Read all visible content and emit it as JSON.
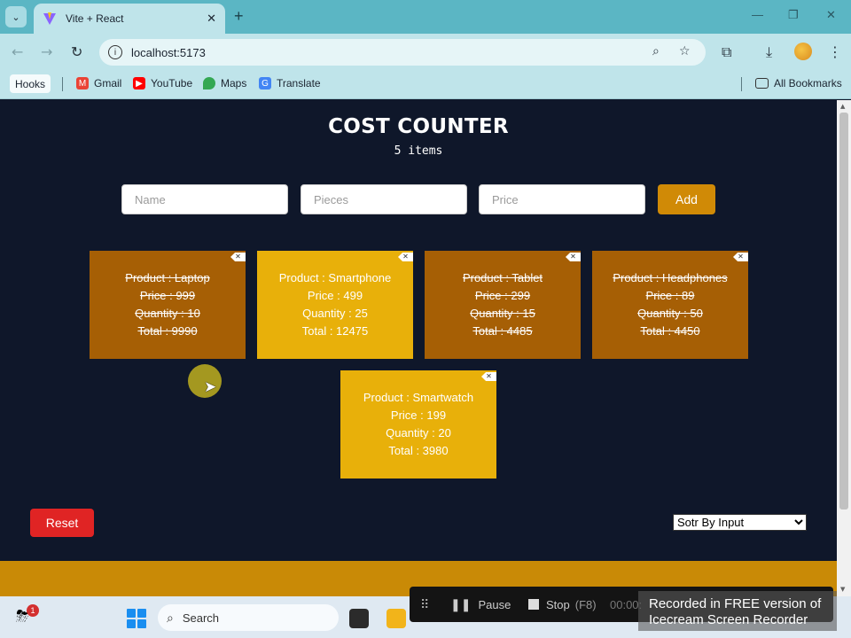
{
  "browser": {
    "tab_title": "Vite + React",
    "url": "localhost:5173",
    "window_controls": {
      "minimize": "—",
      "restore": "❐",
      "close": "✕"
    },
    "bookmarks": [
      {
        "label": "Hooks",
        "icon": "folder-chip"
      },
      {
        "label": "Gmail",
        "icon": "gmail-icon"
      },
      {
        "label": "YouTube",
        "icon": "youtube-icon"
      },
      {
        "label": "Maps",
        "icon": "maps-icon"
      },
      {
        "label": "Translate",
        "icon": "translate-icon"
      }
    ],
    "all_bookmarks_label": "All Bookmarks"
  },
  "app": {
    "title": "COST COUNTER",
    "count_label": "5 items",
    "form": {
      "name_placeholder": "Name",
      "pieces_placeholder": "Pieces",
      "price_placeholder": "Price",
      "add_label": "Add"
    },
    "items": [
      {
        "product": "Product : Laptop",
        "price": "Price : 999",
        "quantity": "Quantity : 10",
        "total": "Total : 9990",
        "status": "done",
        "color": "#a65f05"
      },
      {
        "product": "Product : Smartphone",
        "price": "Price : 499",
        "quantity": "Quantity : 25",
        "total": "Total : 12475",
        "status": "active",
        "color": "#e8b00a"
      },
      {
        "product": "Product : Tablet",
        "price": "Price : 299",
        "quantity": "Quantity : 15",
        "total": "Total : 4485",
        "status": "done",
        "color": "#a65f05"
      },
      {
        "product": "Product : Headphones",
        "price": "Price : 89",
        "quantity": "Quantity : 50",
        "total": "Total : 4450",
        "status": "done",
        "color": "#a65f05"
      },
      {
        "product": "Product : Smartwatch",
        "price": "Price : 199",
        "quantity": "Quantity : 20",
        "total": "Total : 3980",
        "status": "active",
        "color": "#e8b00a"
      }
    ],
    "reset_label": "Reset",
    "sort": {
      "selected": "Sotr By Input"
    },
    "colors": {
      "background": "#0f172a",
      "accent": "#d08a06",
      "reset": "#e02424"
    }
  },
  "taskbar": {
    "notification_badge": "1",
    "search_label": "Search"
  },
  "recorder": {
    "pause_label": "Pause",
    "stop_label": "Stop",
    "stop_shortcut": "(F8)",
    "time": "00:00:",
    "watermark_line1": "Recorded in FREE version of",
    "watermark_line2": "Icecream Screen Recorder"
  }
}
